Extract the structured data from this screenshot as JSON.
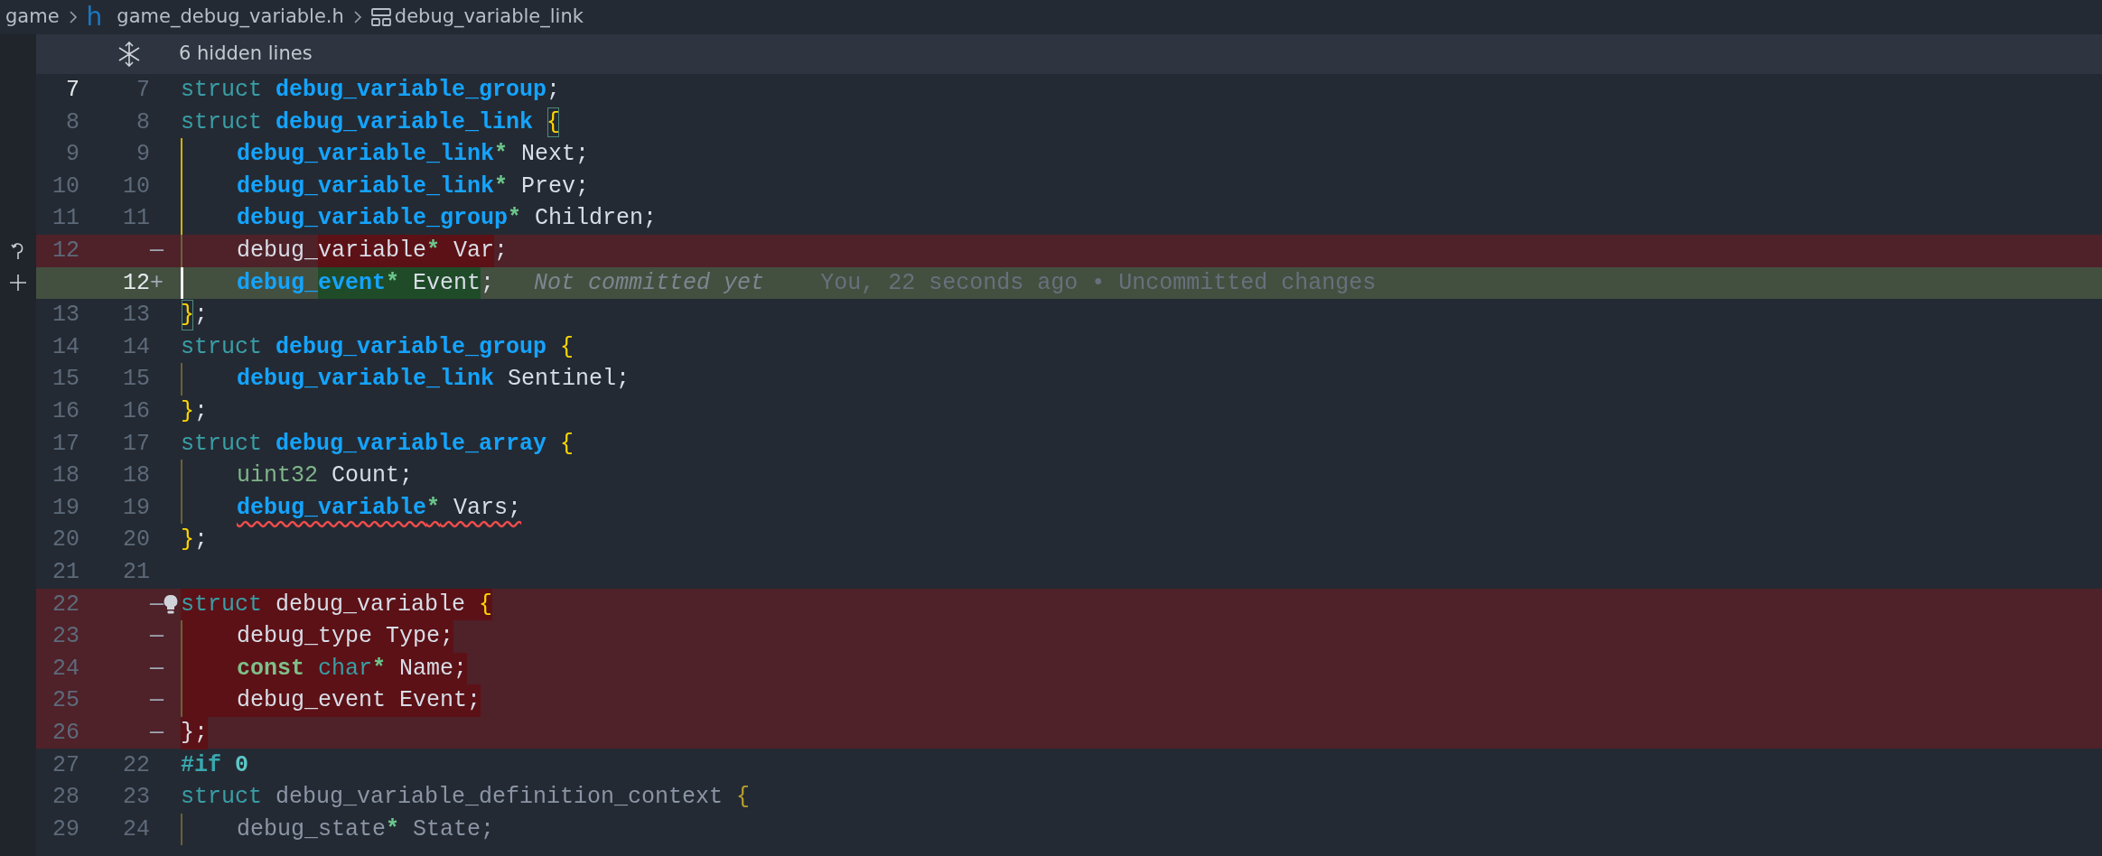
{
  "breadcrumb": [
    {
      "label": "game",
      "kind": "folder"
    },
    {
      "label": "h",
      "kind": "file_icon"
    },
    {
      "label": "game_debug_variable.h",
      "kind": "file"
    },
    {
      "label": "debug_variable_link",
      "kind": "symbol"
    }
  ],
  "hidden_lines": {
    "label": "6 hidden lines"
  },
  "lines": [
    {
      "old": "7",
      "new": "7",
      "kind": "context",
      "current": true,
      "tokens": [
        {
          "text": "struct",
          "kind": "keyword"
        },
        {
          "text": " debug_variable_group",
          "kind": "type"
        },
        {
          "text": ";",
          "kind": "punct"
        }
      ]
    },
    {
      "old": "8",
      "new": "8",
      "kind": "context",
      "current": false,
      "tokens": [
        {
          "text": "struct",
          "kind": "keyword"
        },
        {
          "text": " debug_variable_link ",
          "kind": "type"
        },
        {
          "text": "{",
          "kind": "brace",
          "matched": true
        }
      ]
    },
    {
      "old": "9",
      "new": "9",
      "kind": "context",
      "current": false,
      "indented": true,
      "active_guide": true,
      "tokens": [
        {
          "text": "debug_variable_link",
          "kind": "type"
        },
        {
          "text": "*",
          "kind": "ptr"
        },
        {
          "text": " Next;",
          "kind": "ident"
        }
      ]
    },
    {
      "old": "10",
      "new": "10",
      "kind": "context",
      "current": false,
      "indented": true,
      "active_guide": true,
      "tokens": [
        {
          "text": "debug_variable_link",
          "kind": "type"
        },
        {
          "text": "*",
          "kind": "ptr"
        },
        {
          "text": " Prev;",
          "kind": "ident"
        }
      ]
    },
    {
      "old": "11",
      "new": "11",
      "kind": "context",
      "current": false,
      "indented": true,
      "active_guide": true,
      "tokens": [
        {
          "text": "debug_variable_group",
          "kind": "type"
        },
        {
          "text": "*",
          "kind": "ptr"
        },
        {
          "text": " Children;",
          "kind": "ident"
        }
      ]
    },
    {
      "old": "12",
      "marker": "—",
      "kind": "deleted",
      "current": false,
      "gutter_icon": {
        "kind": "revert"
      },
      "indented": true,
      "active_guide": false,
      "tokens": [
        {
          "text": "debug_",
          "kind": "ident"
        },
        {
          "text": "variable",
          "kind": "ident",
          "changed": true
        },
        {
          "text": "*",
          "kind": "ptr",
          "changed": true
        },
        {
          "text": " Var",
          "kind": "ident",
          "changed": true
        },
        {
          "text": ";",
          "kind": "ident"
        }
      ]
    },
    {
      "new": "12",
      "marker": "+",
      "kind": "added",
      "current": true,
      "gutter_icon": {
        "kind": "add"
      },
      "cursor": true,
      "indented": true,
      "tokens": [
        {
          "text": "debug_",
          "kind": "type"
        },
        {
          "text": "event",
          "kind": "type",
          "changed": true
        },
        {
          "text": "*",
          "kind": "ptr",
          "changed": true
        },
        {
          "text": " Event",
          "kind": "ident",
          "changed": true
        },
        {
          "text": ";",
          "kind": "ident"
        }
      ],
      "blame": {
        "status": "Not committed yet",
        "detail": "You, 22 seconds ago • Uncommitted changes"
      }
    },
    {
      "old": "13",
      "new": "13",
      "kind": "context",
      "current": false,
      "tokens": [
        {
          "text": "}",
          "kind": "brace",
          "matched": true
        },
        {
          "text": ";",
          "kind": "punct"
        }
      ]
    },
    {
      "old": "14",
      "new": "14",
      "kind": "context",
      "current": false,
      "tokens": [
        {
          "text": "struct",
          "kind": "keyword"
        },
        {
          "text": " debug_variable_group ",
          "kind": "type"
        },
        {
          "text": "{",
          "kind": "brace"
        }
      ]
    },
    {
      "old": "15",
      "new": "15",
      "kind": "context",
      "current": false,
      "indented": true,
      "active_guide": false,
      "tokens": [
        {
          "text": "debug_variable_link",
          "kind": "type"
        },
        {
          "text": " Sentinel;",
          "kind": "ident"
        }
      ]
    },
    {
      "old": "16",
      "new": "16",
      "kind": "context",
      "current": false,
      "tokens": [
        {
          "text": "}",
          "kind": "brace"
        },
        {
          "text": ";",
          "kind": "punct"
        }
      ]
    },
    {
      "old": "17",
      "new": "17",
      "kind": "context",
      "current": false,
      "tokens": [
        {
          "text": "struct",
          "kind": "keyword"
        },
        {
          "text": " debug_variable_array ",
          "kind": "type"
        },
        {
          "text": "{",
          "kind": "brace"
        }
      ]
    },
    {
      "old": "18",
      "new": "18",
      "kind": "context",
      "current": false,
      "indented": true,
      "active_guide": false,
      "tokens": [
        {
          "text": "uint32",
          "kind": "builtin"
        },
        {
          "text": " Count;",
          "kind": "ident"
        }
      ]
    },
    {
      "old": "19",
      "new": "19",
      "kind": "context",
      "current": false,
      "indented": true,
      "active_guide": false,
      "squiggle": true,
      "tokens": [
        {
          "text": "debug_variable",
          "kind": "type"
        },
        {
          "text": "*",
          "kind": "ptr"
        },
        {
          "text": " Vars;",
          "kind": "ident"
        }
      ]
    },
    {
      "old": "20",
      "new": "20",
      "kind": "context",
      "current": false,
      "tokens": [
        {
          "text": "}",
          "kind": "brace"
        },
        {
          "text": ";",
          "kind": "punct"
        }
      ]
    },
    {
      "old": "21",
      "new": "21",
      "kind": "context",
      "current": false
    },
    {
      "old": "22",
      "marker": "—",
      "kind": "deleted",
      "current": false,
      "lightbulb": true,
      "tokens": [
        {
          "text": "struct",
          "kind": "keyword",
          "changed": true
        },
        {
          "text": " debug_variable ",
          "kind": "ident",
          "changed": true
        },
        {
          "text": "{",
          "kind": "brace",
          "changed": true
        }
      ]
    },
    {
      "old": "23",
      "marker": "—",
      "kind": "deleted",
      "current": false,
      "indented": true,
      "active_guide": false,
      "whole_changed": true,
      "tokens": [
        {
          "text": "debug_type Type;",
          "kind": "ident",
          "changed": true
        }
      ]
    },
    {
      "old": "24",
      "marker": "—",
      "kind": "deleted",
      "current": false,
      "indented": true,
      "active_guide": false,
      "whole_changed": true,
      "tokens": [
        {
          "text": "const",
          "kind": "qualifier",
          "changed": true
        },
        {
          "text": " char",
          "kind": "keyword",
          "changed": true
        },
        {
          "text": "*",
          "kind": "ptr",
          "changed": true
        },
        {
          "text": " Name;",
          "kind": "ident",
          "changed": true
        }
      ]
    },
    {
      "old": "25",
      "marker": "—",
      "kind": "deleted",
      "current": false,
      "indented": true,
      "active_guide": false,
      "whole_changed": true,
      "tokens": [
        {
          "text": "debug_event Event;",
          "kind": "ident",
          "changed": true
        }
      ]
    },
    {
      "old": "26",
      "marker": "—",
      "kind": "deleted",
      "current": false,
      "tokens": [
        {
          "text": "};",
          "kind": "ident",
          "changed": true
        }
      ]
    },
    {
      "old": "27",
      "new": "22",
      "kind": "context",
      "current": false,
      "tokens": [
        {
          "text": "#if",
          "kind": "preproc"
        },
        {
          "text": " 0",
          "kind": "number"
        }
      ]
    },
    {
      "old": "28",
      "new": "23",
      "kind": "context",
      "current": false,
      "tokens": [
        {
          "text": "struct",
          "kind": "keyword"
        },
        {
          "text": " debug_variable_definition_context ",
          "kind": "inactive"
        },
        {
          "text": "{",
          "kind": "inactive_brace"
        }
      ]
    },
    {
      "old": "29",
      "new": "24",
      "kind": "context",
      "current": false,
      "indented": true,
      "active_guide": false,
      "tokens": [
        {
          "text": "debug_state",
          "kind": "inactive"
        },
        {
          "text": "*",
          "kind": "ptr"
        },
        {
          "text": " State;",
          "kind": "inactive"
        }
      ]
    }
  ]
}
